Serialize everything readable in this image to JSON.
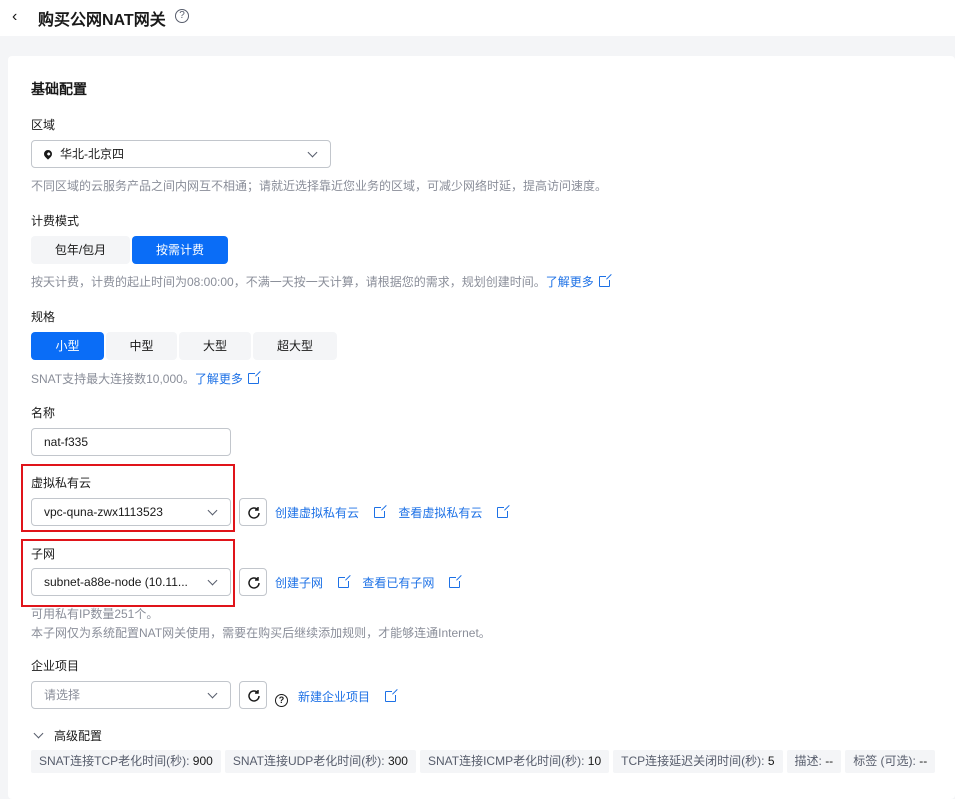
{
  "header": {
    "back_icon": "chevron-left-icon",
    "title": "购买公网NAT网关",
    "help_icon": "question-circle-icon"
  },
  "basic": {
    "section_title": "基础配置",
    "region": {
      "label": "区域",
      "value": "华北-北京四",
      "hint": "不同区域的云服务产品之间内网互不相通；请就近选择靠近您业务的区域，可减少网络时延，提高访问速度。"
    },
    "billing": {
      "label": "计费模式",
      "options": [
        "包年/包月",
        "按需计费"
      ],
      "selected": "按需计费",
      "hint": "按天计费，计费的起止时间为08:00:00，不满一天按一天计算，请根据您的需求，规划创建时间。",
      "learn_more": "了解更多"
    },
    "spec": {
      "label": "规格",
      "options": [
        "小型",
        "中型",
        "大型",
        "超大型"
      ],
      "selected": "小型",
      "hint": "SNAT支持最大连接数10,000。",
      "learn_more": "了解更多"
    },
    "name": {
      "label": "名称",
      "value": "nat-f335"
    },
    "vpc": {
      "label": "虚拟私有云",
      "value": "vpc-quna-zwx1113523",
      "create_link": "创建虚拟私有云",
      "view_link": "查看虚拟私有云"
    },
    "subnet": {
      "label": "子网",
      "value": "subnet-a88e-node (10.11...",
      "create_link": "创建子网",
      "view_link": "查看已有子网",
      "hint1": "可用私有IP数量251个。",
      "hint2": "本子网仅为系统配置NAT网关使用，需要在购买后继续添加规则，才能够连通Internet。"
    },
    "enterprise": {
      "label": "企业项目",
      "placeholder": "请选择",
      "create_link": "新建企业项目"
    }
  },
  "advanced": {
    "label": "高级配置",
    "items": [
      {
        "key": "SNAT连接TCP老化时间(秒):",
        "value": "900"
      },
      {
        "key": "SNAT连接UDP老化时间(秒):",
        "value": "300"
      },
      {
        "key": "SNAT连接ICMP老化时间(秒):",
        "value": "10"
      },
      {
        "key": "TCP连接延迟关闭时间(秒):",
        "value": "5"
      },
      {
        "key": "描述:",
        "value": "--"
      },
      {
        "key": "标签 (可选):",
        "value": "--"
      }
    ]
  },
  "colors": {
    "primary": "#0a6df7",
    "link": "#1d71e6",
    "highlight": "#e0141a"
  }
}
